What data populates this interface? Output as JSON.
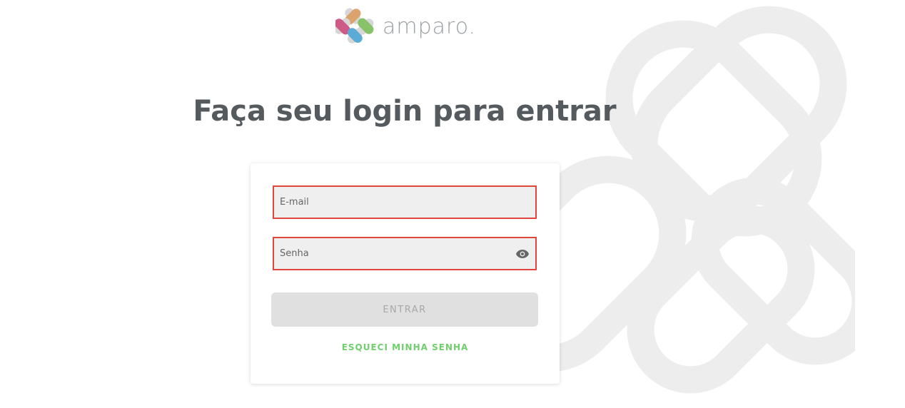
{
  "brand": {
    "name": "amparo."
  },
  "heading": "Faça seu login para entrar",
  "form": {
    "email_placeholder": "E-mail",
    "password_placeholder": "Senha",
    "show_password_icon": "eye-icon",
    "submit_label": "ENTRAR",
    "forgot_label": "ESQUECI MINHA SENHA"
  },
  "colors": {
    "error_border": "#e0463c",
    "link": "#6fcf6a",
    "heading": "#545a5e"
  }
}
